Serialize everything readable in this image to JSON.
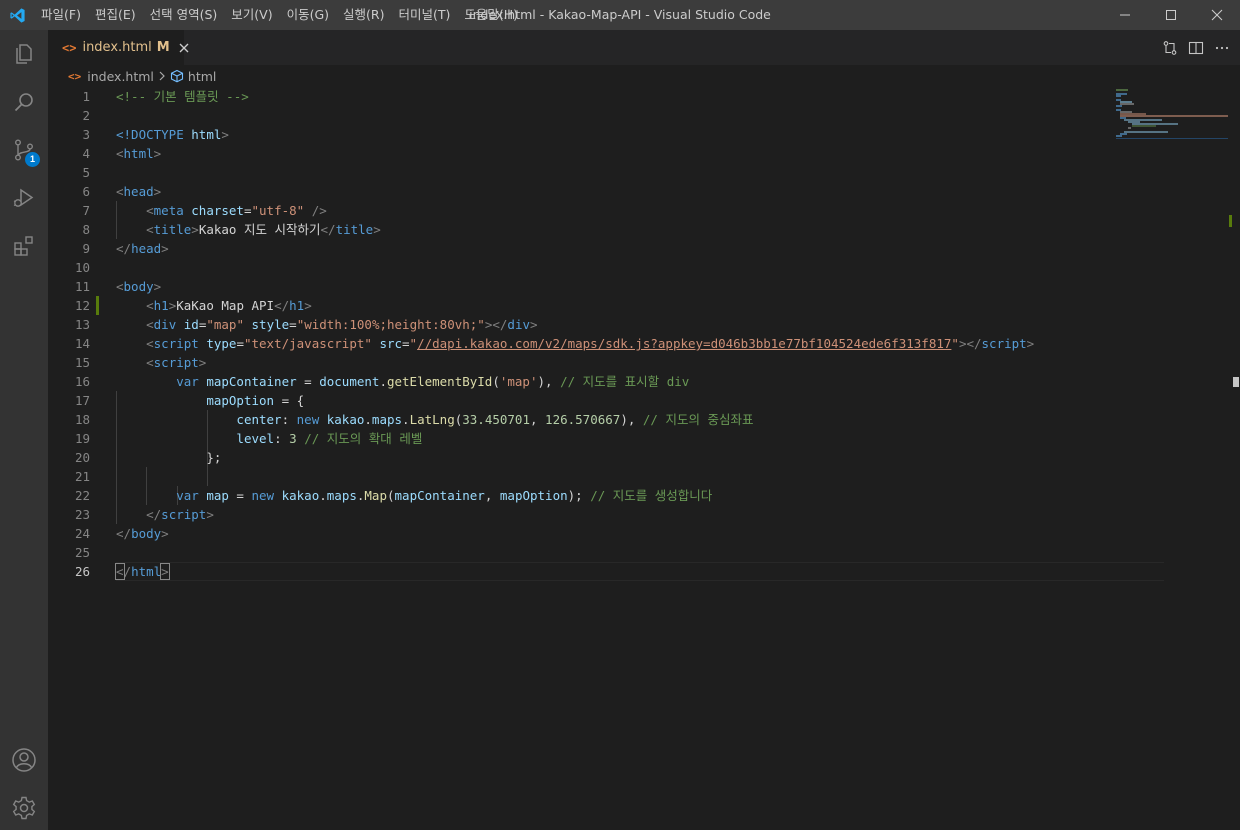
{
  "window": {
    "title": "index.html - Kakao-Map-API - Visual Studio Code"
  },
  "menu": [
    {
      "label": "파일(F)"
    },
    {
      "label": "편집(E)"
    },
    {
      "label": "선택 영역(S)"
    },
    {
      "label": "보기(V)"
    },
    {
      "label": "이동(G)"
    },
    {
      "label": "실행(R)"
    },
    {
      "label": "터미널(T)"
    },
    {
      "label": "도움말(H)"
    }
  ],
  "activity_bar": {
    "items": [
      {
        "icon": "explorer-icon"
      },
      {
        "icon": "search-icon"
      },
      {
        "icon": "source-control-icon",
        "badge": "1"
      },
      {
        "icon": "run-debug-icon"
      },
      {
        "icon": "extensions-icon"
      }
    ],
    "bottom": [
      {
        "icon": "account-icon"
      },
      {
        "icon": "settings-gear-icon"
      }
    ]
  },
  "tab": {
    "icon": "<>",
    "label": "index.html",
    "modified": "M"
  },
  "breadcrumb": {
    "file_icon": "<>",
    "file": "index.html",
    "symbol": "html"
  },
  "editor": {
    "active_line": 26,
    "line_numbers": [
      "1",
      "2",
      "3",
      "4",
      "5",
      "6",
      "7",
      "8",
      "9",
      "10",
      "11",
      "12",
      "13",
      "14",
      "15",
      "16",
      "17",
      "18",
      "19",
      "20",
      "21",
      "22",
      "23",
      "24",
      "25",
      "26"
    ],
    "tokens": {
      "l1_comment": "<!-- 기본 템플릿 -->",
      "l3_doctype": "<!DOCTYPE ",
      "l3_html": "html",
      "l3_close": ">",
      "l4_open": "<",
      "l4_tag": "html",
      "l4_close": ">",
      "l6_tag": "head",
      "l7_tag": "meta",
      "l7_attr": "charset",
      "l7_val": "\"utf-8\"",
      "l7_end": " />",
      "l8_tag": "title",
      "l8_text": "Kakao 지도 시작하기",
      "l8_endtag": "title",
      "l9_tag": "head",
      "l11_tag": "body",
      "l12_tag": "h1",
      "l12_text": "KaKao Map API",
      "l12_endtag": "h1",
      "l13_tag": "div",
      "l13_attr1": "id",
      "l13_val1": "\"map\"",
      "l13_attr2": "style",
      "l13_val2": "\"width:100%;height:80vh;\"",
      "l13_endtag": "div",
      "l14_tag": "script",
      "l14_attr1": "type",
      "l14_val1": "\"text/javascript\"",
      "l14_attr2": "src",
      "l14_q1": "\"",
      "l14_url": "//dapi.kakao.com/v2/maps/sdk.js?appkey=d046b3bb1e77bf104524ede6f313f817",
      "l14_q2": "\"",
      "l14_endtag": "script",
      "l15_tag": "script",
      "l16_kw": "var",
      "l16_var": "mapContainer",
      "l16_eq": " = ",
      "l16_obj": "document",
      "l16_fn": "getElementById",
      "l16_arg": "'map'",
      "l16_comment": "// 지도를 표시할 div",
      "l17_var": "mapOption",
      "l17_rest": " = {",
      "l18_prop": "center",
      "l18_kw": "new",
      "l18_ns1": "kakao",
      "l18_ns2": "maps",
      "l18_fn": "LatLng",
      "l18_n1": "33.450701",
      "l18_n2": "126.570667",
      "l18_comment": "// 지도의 중심좌표",
      "l19_prop": "level",
      "l19_num": "3",
      "l19_comment": "// 지도의 확대 레벨",
      "l20_text": "};",
      "l22_kw": "var",
      "l22_var": "map",
      "l22_kw2": "new",
      "l22_ns1": "kakao",
      "l22_ns2": "maps",
      "l22_fn": "Map",
      "l22_a1": "mapContainer",
      "l22_a2": "mapOption",
      "l22_comment": "// 지도를 생성합니다",
      "l23_tag": "script",
      "l24_tag": "body",
      "l26_tag": "html"
    }
  },
  "colors": {
    "accent": "#007acc",
    "modified_gutter": "#587c0c",
    "tab_modified_text": "#e2c08d"
  }
}
